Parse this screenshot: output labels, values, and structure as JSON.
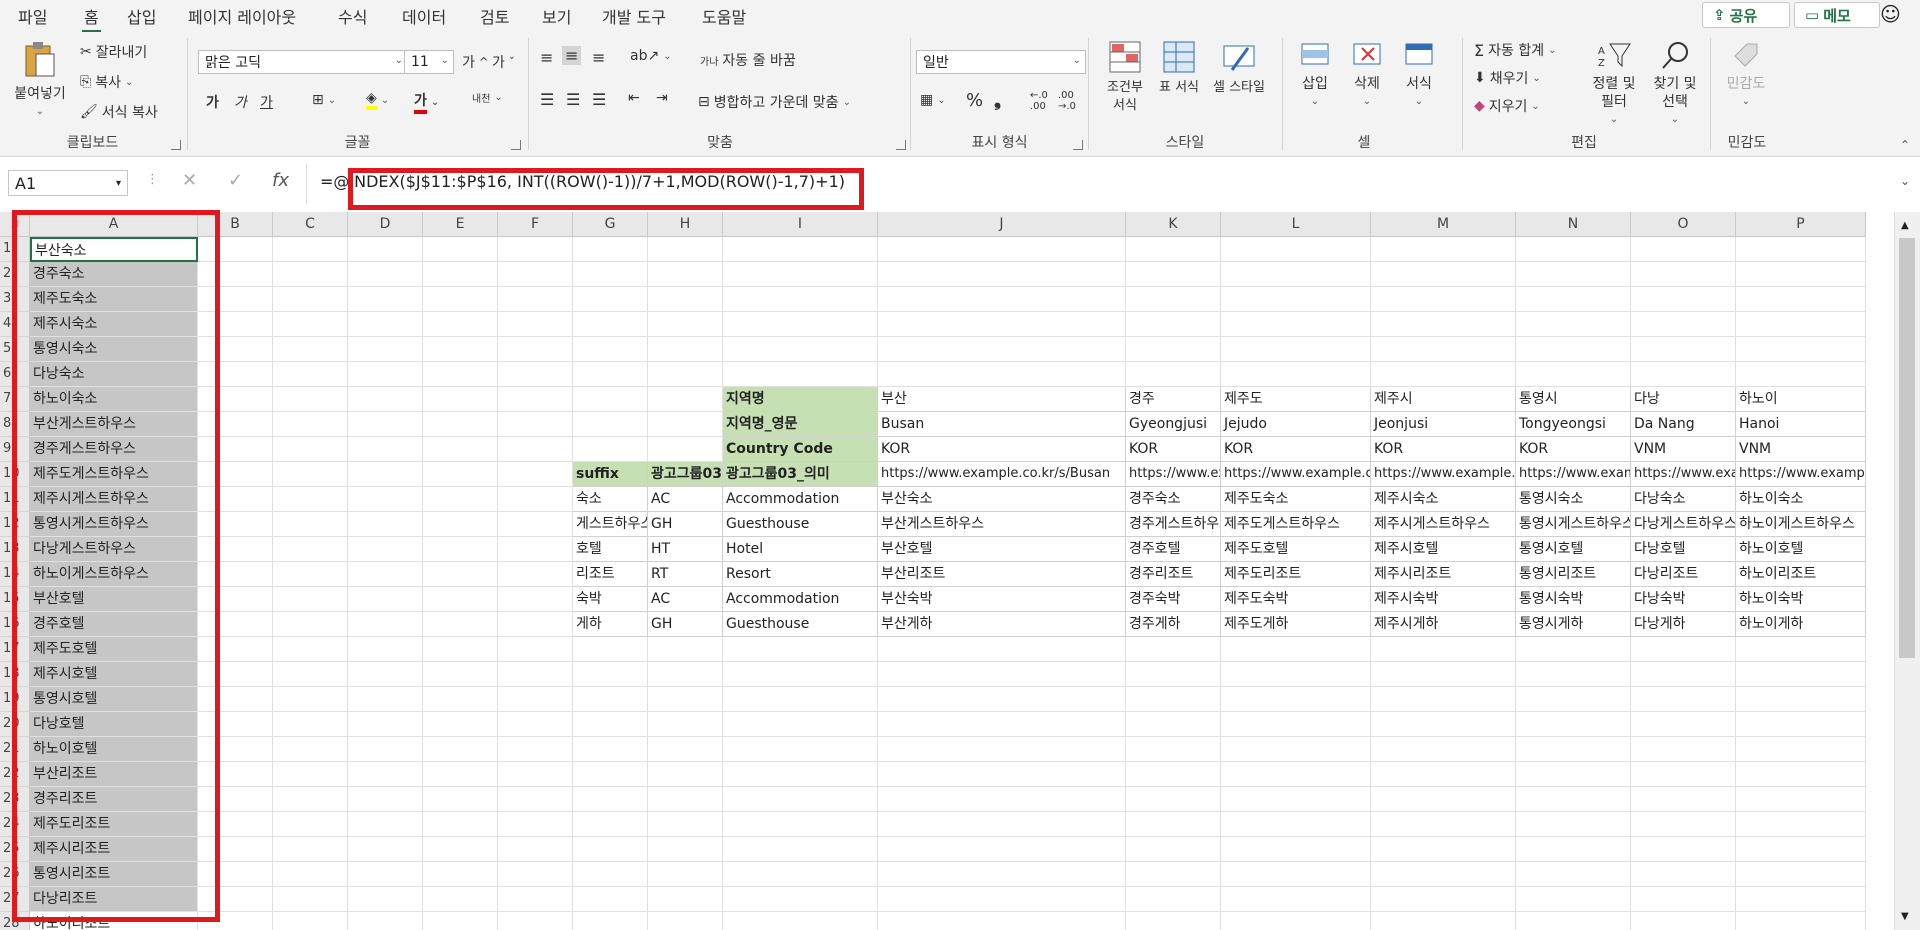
{
  "menu": {
    "tabs": [
      "파일",
      "홈",
      "삽입",
      "페이지 레이아웃",
      "수식",
      "데이터",
      "검토",
      "보기",
      "개발 도구",
      "도움말"
    ],
    "share": "공유",
    "memo": "메모"
  },
  "ribbon": {
    "clipboard": {
      "paste": "붙여넣기",
      "cut": "잘라내기",
      "copy": "복사",
      "format_painter": "서식 복사",
      "label": "클립보드"
    },
    "font": {
      "name": "맑은 고딕",
      "size": "11",
      "bold": "가",
      "italic": "가",
      "underline": "가",
      "label": "글꼴"
    },
    "align": {
      "wrap": "자동 줄 바꿈",
      "merge": "병합하고 가운데 맞춤",
      "label": "맞춤"
    },
    "number": {
      "format": "일반",
      "label": "표시 형식"
    },
    "styles": {
      "conditional": "조건부 서식",
      "table": "표 서식",
      "cell": "셀 스타일",
      "label": "스타일"
    },
    "cells": {
      "insert": "삽입",
      "delete": "삭제",
      "format": "서식",
      "label": "셀"
    },
    "editing": {
      "autosum": "자동 합계",
      "fill": "채우기",
      "clear": "지우기",
      "sort": "정렬 및 필터",
      "find": "찾기 및 선택",
      "label": "편집"
    },
    "sensitivity": {
      "btn": "민감도",
      "label": "민감도"
    }
  },
  "formula_bar": {
    "name": "A1",
    "formula": "=@INDEX($J$11:$P$16, INT((ROW()-1))/7+1,MOD(ROW()-1,7)+1)"
  },
  "grid": {
    "columns": [
      "A",
      "B",
      "C",
      "D",
      "E",
      "F",
      "G",
      "H",
      "I",
      "J",
      "K",
      "L",
      "M",
      "N",
      "O",
      "P"
    ],
    "colA": [
      "부산숙소",
      "경주숙소",
      "제주도숙소",
      "제주시숙소",
      "통영시숙소",
      "다낭숙소",
      "하노이숙소",
      "부산게스트하우스",
      "경주게스트하우스",
      "제주도게스트하우스",
      "제주시게스트하우스",
      "통영시게스트하우스",
      "다낭게스트하우스",
      "하노이게스트하우스",
      "부산호텔",
      "경주호텔",
      "제주도호텔",
      "제주시호텔",
      "통영시호텔",
      "다낭호텔",
      "하노이호텔",
      "부산리조트",
      "경주리조트",
      "제주도리조트",
      "제주시리조트",
      "통영시리조트",
      "다낭리조트"
    ],
    "row28_partial": "하노이리조트",
    "labels": {
      "region": "지역명",
      "region_en": "지역명_영문",
      "country": "Country Code",
      "suffix": "suffix",
      "group03": "광고그룹03",
      "group03_meaning": "광고그룹03_의미"
    },
    "regions": [
      "부산",
      "경주",
      "제주도",
      "제주시",
      "통영시",
      "다낭",
      "하노이"
    ],
    "regions_en": [
      "Busan",
      "Gyeongjusi",
      "Jejudo",
      "Jeonjusi",
      "Tongyeongsi",
      "Da Nang",
      "Hanoi"
    ],
    "countries": [
      "KOR",
      "KOR",
      "KOR",
      "KOR",
      "KOR",
      "VNM",
      "VNM"
    ],
    "urls": [
      "https://www.example.co.kr/s/Busan",
      "https://www.example.co.kr/s/Gyeongjusi",
      "https://www.example.co.kr/s/Jejudo",
      "https://www.example.co.kr/s/Jeonjusi",
      "https://www.example.co.kr/s/Tongyeongsi",
      "https://www.example.co.kr/s/DaNang",
      "https://www.example.co.kr/s/Hanoi"
    ],
    "rows": [
      {
        "suffix": "숙소",
        "code": "AC",
        "meaning": "Accommodation",
        "vals": [
          "부산숙소",
          "경주숙소",
          "제주도숙소",
          "제주시숙소",
          "통영시숙소",
          "다낭숙소",
          "하노이숙소"
        ]
      },
      {
        "suffix": "게스트하우스",
        "code": "GH",
        "meaning": "Guesthouse",
        "vals": [
          "부산게스트하우스",
          "경주게스트하우스",
          "제주도게스트하우스",
          "제주시게스트하우스",
          "통영시게스트하우스",
          "다낭게스트하우스",
          "하노이게스트하우스"
        ]
      },
      {
        "suffix": "호텔",
        "code": "HT",
        "meaning": "Hotel",
        "vals": [
          "부산호텔",
          "경주호텔",
          "제주도호텔",
          "제주시호텔",
          "통영시호텔",
          "다낭호텔",
          "하노이호텔"
        ]
      },
      {
        "suffix": "리조트",
        "code": "RT",
        "meaning": "Resort",
        "vals": [
          "부산리조트",
          "경주리조트",
          "제주도리조트",
          "제주시리조트",
          "통영시리조트",
          "다낭리조트",
          "하노이리조트"
        ]
      },
      {
        "suffix": "숙박",
        "code": "AC",
        "meaning": "Accommodation",
        "vals": [
          "부산숙박",
          "경주숙박",
          "제주도숙박",
          "제주시숙박",
          "통영시숙박",
          "다낭숙박",
          "하노이숙박"
        ]
      },
      {
        "suffix": "게하",
        "code": "GH",
        "meaning": "Guesthouse",
        "vals": [
          "부산게하",
          "경주게하",
          "제주도게하",
          "제주시게하",
          "통영시게하",
          "다낭게하",
          "하노이게하"
        ]
      }
    ]
  }
}
